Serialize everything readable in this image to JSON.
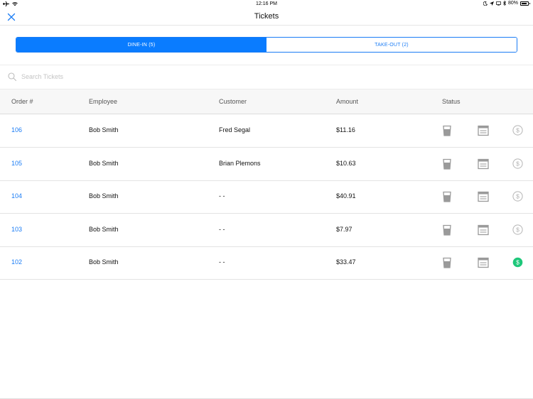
{
  "status_bar": {
    "time": "12:16 PM",
    "battery": "80%"
  },
  "nav": {
    "title": "Tickets"
  },
  "segments": [
    {
      "label": "DINE-IN (5)",
      "active": true
    },
    {
      "label": "TAKE-OUT (2)",
      "active": false
    }
  ],
  "search": {
    "placeholder": "Search Tickets"
  },
  "table": {
    "headers": {
      "order": "Order #",
      "employee": "Employee",
      "customer": "Customer",
      "amount": "Amount",
      "status": "Status"
    },
    "rows": [
      {
        "order": "106",
        "employee": "Bob Smith",
        "customer": "Fred Segal",
        "amount": "$11.16",
        "paid": false
      },
      {
        "order": "105",
        "employee": "Bob Smith",
        "customer": "Brian Plemons",
        "amount": "$10.63",
        "paid": false
      },
      {
        "order": "104",
        "employee": "Bob Smith",
        "customer": "- -",
        "amount": "$40.91",
        "paid": false
      },
      {
        "order": "103",
        "employee": "Bob Smith",
        "customer": "- -",
        "amount": "$7.97",
        "paid": false
      },
      {
        "order": "102",
        "employee": "Bob Smith",
        "customer": "- -",
        "amount": "$33.47",
        "paid": true
      }
    ]
  },
  "colors": {
    "accent": "#0a7cff",
    "paid": "#1ec77a",
    "status_icon": "#9a9a9a"
  },
  "icons": {
    "close": "close-icon",
    "search": "search-icon",
    "drink": "glass-icon",
    "receipt": "receipt-icon",
    "payment": "dollar-circle-icon"
  }
}
